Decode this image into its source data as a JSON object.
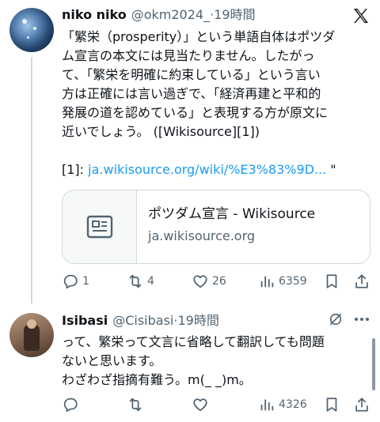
{
  "tweet1": {
    "display_name": "niko niko",
    "handle": "@okm2024_",
    "separator": "·",
    "time": "19時間",
    "text_lines": [
      "「繁栄（prosperity）」という単語自体はポツダ",
      "ム宣言の本文には見当たりません。したがっ",
      "て、「繁栄を明確に約束している」という言い",
      "方は正確には言い過ぎで、「経済再建と平和的",
      "発展の道を認めている」と表現する方が原文に",
      "近いでしょう。 ([Wikisource][1])"
    ],
    "ref_prefix": "[1]: ",
    "ref_link": "ja.wikisource.org/wiki/%E3%83%9D...",
    "ref_suffix": " \"",
    "card": {
      "title": "ポツダム宣言 - Wikisource",
      "domain": "ja.wikisource.org",
      "thumb_icon": "article-icon"
    },
    "actions": {
      "replies": "1",
      "reposts": "4",
      "likes": "26",
      "views": "6359"
    }
  },
  "tweet2": {
    "display_name": "Isibasi",
    "handle": "@Cisibasi",
    "separator": "·",
    "time": "19時間",
    "text_lines": [
      "って、繁栄って文言に省略して翻訳しても問題",
      "ないと思います。",
      "わざわざ指摘有難う。m(_ _)m。"
    ],
    "actions": {
      "replies": "",
      "reposts": "",
      "likes": "",
      "views": "4326"
    }
  },
  "colors": {
    "text": "#0f1419",
    "secondary": "#536471",
    "link": "#1d9bf0",
    "border": "#cfd9de"
  }
}
